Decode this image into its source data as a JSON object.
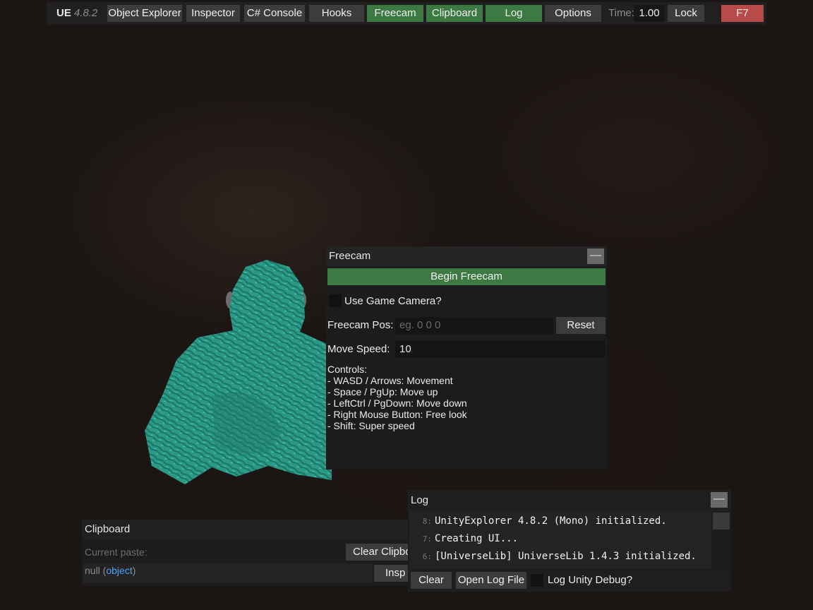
{
  "topbar": {
    "brand": "UE",
    "version": "4.8.2",
    "tabs": [
      {
        "label": "Object Explorer",
        "active": false
      },
      {
        "label": "Inspector",
        "active": false
      },
      {
        "label": "C# Console",
        "active": false
      },
      {
        "label": "Hooks",
        "active": false
      },
      {
        "label": "Freecam",
        "active": true
      },
      {
        "label": "Clipboard",
        "active": true
      },
      {
        "label": "Log",
        "active": true
      },
      {
        "label": "Options",
        "active": false
      }
    ],
    "time_label": "Time:",
    "time_value": "1.00",
    "lock_label": "Lock",
    "hotkey_label": "F7"
  },
  "freecam": {
    "title": "Freecam",
    "minimize_glyph": "—",
    "begin_label": "Begin Freecam",
    "use_game_camera_label": "Use Game Camera?",
    "pos_label": "Freecam Pos:",
    "pos_placeholder": "eg. 0 0 0",
    "reset_label": "Reset",
    "speed_label": "Move Speed:",
    "speed_value": "10",
    "controls_lines": [
      "Controls:",
      "- WASD / Arrows: Movement",
      "- Space / PgUp: Move up",
      "- LeftCtrl / PgDown: Move down",
      "- Right Mouse Button: Free look",
      "- Shift: Super speed"
    ]
  },
  "clipboard": {
    "title": "Clipboard",
    "current_paste_label": "Current paste:",
    "clear_label": "Clear Clipbo",
    "value_null": "null",
    "value_paren_open": " (",
    "value_type": "object",
    "value_paren_close": ")",
    "inspect_label": "Insp"
  },
  "log": {
    "title": "Log",
    "minimize_glyph": "—",
    "lines": [
      {
        "num": "8:",
        "text": "UnityExplorer 4.8.2 (Mono) initialized."
      },
      {
        "num": "7:",
        "text": "Creating UI..."
      },
      {
        "num": "6:",
        "text": "[UniverseLib] UniverseLib 1.4.3 initialized."
      }
    ],
    "clear_label": "Clear",
    "open_file_label": "Open Log File",
    "unity_debug_label": "Log Unity Debug?"
  },
  "colors": {
    "active_tab": "#3d7a43",
    "hotkey": "#b84a4a",
    "button": "#3c3c3c",
    "panel_bg": "#1c1c1c",
    "character": "#2b9c8a",
    "link": "#4aa3ff"
  }
}
